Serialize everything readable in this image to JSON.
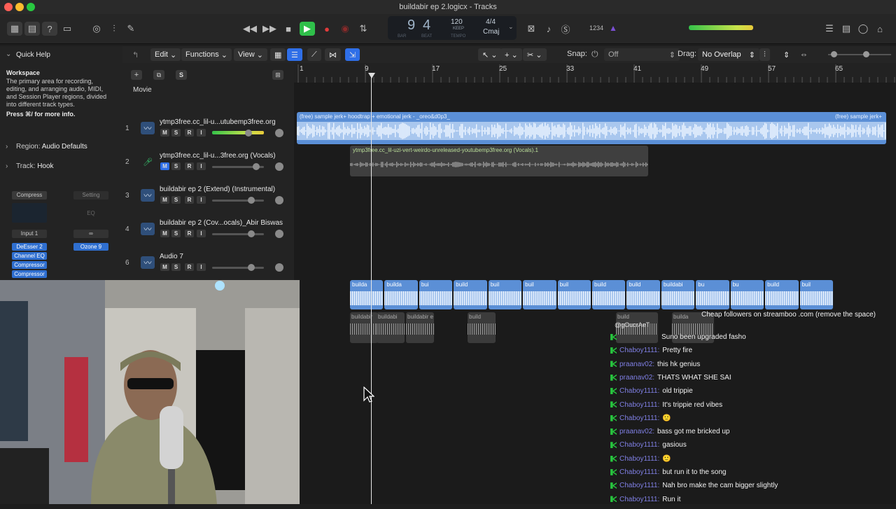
{
  "window": {
    "title": "buildabir ep 2.logicx - Tracks"
  },
  "lcd": {
    "bar": "9",
    "beat": "4",
    "bar_caption": "BAR",
    "beat_caption": "BEAT",
    "tempo": "120",
    "tempo_mode": "KEEP",
    "tempo_caption": "TEMPO",
    "signature": "4/4",
    "key": "Cmaj",
    "count_in": "1234"
  },
  "quick_help": {
    "title": "Quick Help",
    "heading": "Workspace",
    "body": "The primary area for recording, editing, and arranging audio, MIDI, and Session Player regions, divided into different track types.",
    "more": "Press ⌘/ for more info."
  },
  "inspector": {
    "region_label": "Region:",
    "region_value": "Audio Defaults",
    "track_label": "Track:",
    "track_value": "Hook",
    "plugin1": "Compress",
    "setting": "Setting",
    "eq": "EQ",
    "input": "Input 1",
    "plugins": [
      "DeEsser 2",
      "Channel EQ",
      "Compressor",
      "Compressor"
    ],
    "ozone": "Ozone 9"
  },
  "tracks_bar": {
    "edit": "Edit",
    "functions": "Functions",
    "view": "View",
    "snap_label": "Snap:",
    "snap_value": "Off",
    "drag_label": "Drag:",
    "drag_value": "No Overlap"
  },
  "movie_label": "Movie",
  "s_button": "S",
  "ruler": [
    "1",
    "9",
    "17",
    "25",
    "33",
    "41",
    "49",
    "57",
    "65"
  ],
  "tracks": [
    {
      "num": "1",
      "name": "ytmp3free.cc_lil-u...utubemp3free.org"
    },
    {
      "num": "2",
      "name": "ytmp3free.cc_lil-u...3free.org (Vocals)"
    },
    {
      "num": "3",
      "name": "buildabir ep 2 (Extend) (Instrumental)"
    },
    {
      "num": "4",
      "name": "buildabir ep 2 (Cov...ocals)_Abir Biswas"
    },
    {
      "num": "6",
      "name": "Audio 7"
    }
  ],
  "msr": {
    "m": "M",
    "s": "S",
    "r": "R",
    "i": "I"
  },
  "regions": {
    "r1": "(free) sample jerk+ hoodtrap + emotional jerk - _oreo&d0p3_",
    "r1b": "(free) sample jerk+",
    "r2": "ytmp3free.cc_lil-uzi-vert-weirdo-unreleased-youtubemp3free.org (Vocals).1",
    "small": [
      "builda",
      "builda",
      "bui",
      "build",
      "buil",
      "buil",
      "buil",
      "build",
      "build",
      "buildabi",
      "bu",
      "bu",
      "build",
      "buil"
    ],
    "small2": [
      "buildabir",
      "buildabi",
      "buildabir e",
      "build",
      "build",
      "builda"
    ]
  },
  "chat": {
    "promo": "Cheap followers on streamboo .com (remove the space)",
    "promo_user": "@gOucrAeT",
    "lines": [
      {
        "user": "",
        "msg": "Suno been upgraded fasho"
      },
      {
        "user": "Chaboy1111:",
        "msg": "Pretty fire"
      },
      {
        "user": "praanav02:",
        "msg": "this hk genius"
      },
      {
        "user": "praanav02:",
        "msg": "THATS WHAT SHE SAI"
      },
      {
        "user": "Chaboy1111:",
        "msg": "old trippie"
      },
      {
        "user": "Chaboy1111:",
        "msg": "It's trippie red vibes"
      },
      {
        "user": "Chaboy1111:",
        "msg": "🙂"
      },
      {
        "user": "praanav02:",
        "msg": "bass got me bricked up"
      },
      {
        "user": "Chaboy1111:",
        "msg": "gasious"
      },
      {
        "user": "Chaboy1111:",
        "msg": "🙂"
      },
      {
        "user": "Chaboy1111:",
        "msg": "but run it to the song"
      },
      {
        "user": "Chaboy1111:",
        "msg": "Nah bro make the cam bigger slightly"
      },
      {
        "user": "Chaboy1111:",
        "msg": "Run it"
      }
    ]
  },
  "colors": {
    "region_blue": "#5b8fd6",
    "region_light": "#a9c7ee",
    "record": "#e23b3b",
    "play": "#2fbf4a",
    "accent": "#2f6fe8"
  }
}
